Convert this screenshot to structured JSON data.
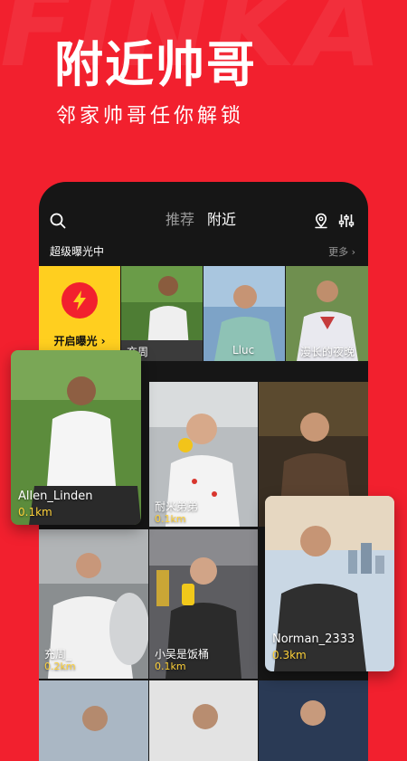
{
  "hero": {
    "bg_letters": "FINKA",
    "title": "附近帅哥",
    "subtitle": "邻家帅哥任你解锁"
  },
  "app": {
    "tabs": [
      {
        "label": "推荐",
        "active": false
      },
      {
        "label": "附近",
        "active": true
      }
    ],
    "icons": {
      "search": "search-icon",
      "location": "location-pin-icon",
      "filter": "filter-sliders-icon"
    },
    "boost_section": {
      "title": "超级曝光中",
      "more": "更多 ›",
      "boost_button": "开启曝光 ›",
      "boost_icon": "lightning-icon",
      "users": [
        {
          "name": "充周"
        },
        {
          "name": "Lluc"
        },
        {
          "name": "漫长的夜晚"
        }
      ]
    },
    "nearby_users": [
      {
        "name": "耐米弟弟",
        "distance": "0.1km"
      },
      {
        "name": "",
        "distance": ""
      },
      {
        "name": "充周_",
        "distance": "0.2km"
      },
      {
        "name": "小吴是饭桶",
        "distance": "0.1km"
      }
    ],
    "featured_cards": [
      {
        "name": "Allen_Linden",
        "distance": "0.1km"
      },
      {
        "name": "Norman_2333",
        "distance": "0.3km"
      }
    ]
  },
  "colors": {
    "brand_red": "#f2202e",
    "boost_yellow": "#ffcf1f",
    "distance_yellow": "#ffd23a",
    "app_bg": "#161616"
  }
}
